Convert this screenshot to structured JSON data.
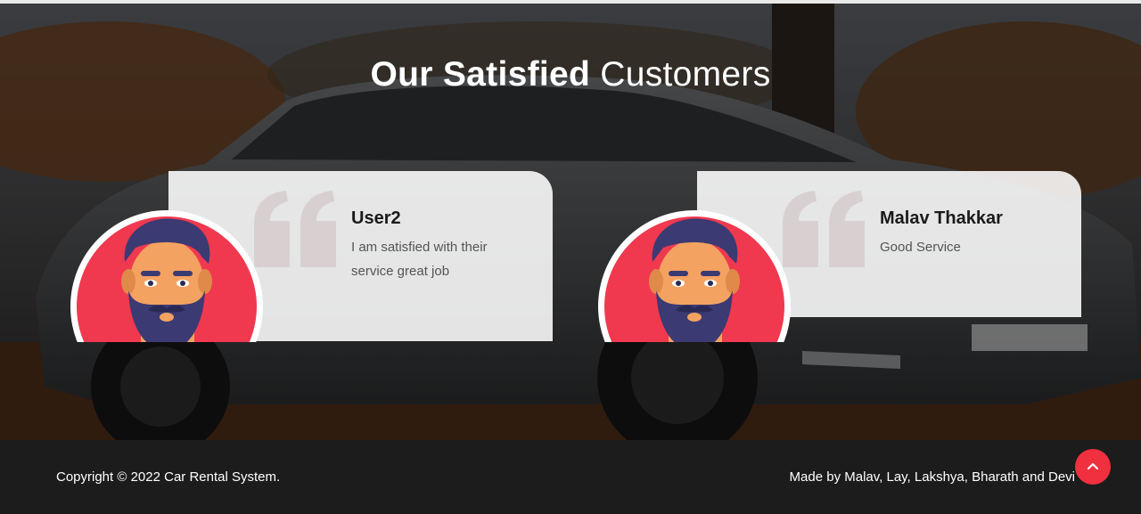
{
  "section": {
    "title_bold": "Our Satisfied",
    "title_light": "Customers"
  },
  "testimonials": [
    {
      "name": "User2",
      "text": "I am satisfied with their service great job",
      "avatar_icon": "bearded-man-avatar-icon"
    },
    {
      "name": "Malav Thakkar",
      "text": "Good Service",
      "avatar_icon": "bearded-man-avatar-icon"
    }
  ],
  "footer": {
    "copyright": "Copyright © 2022 Car Rental System.",
    "made_by": "Made by Malav, Lay, Lakshya, Bharath and Devi",
    "scroll_top_icon": "chevron-up-icon"
  },
  "colors": {
    "accent": "#f0303e",
    "footer_bg": "#1c1c1c",
    "avatar_bg": "#f0394f",
    "hair": "#3b3a73"
  }
}
